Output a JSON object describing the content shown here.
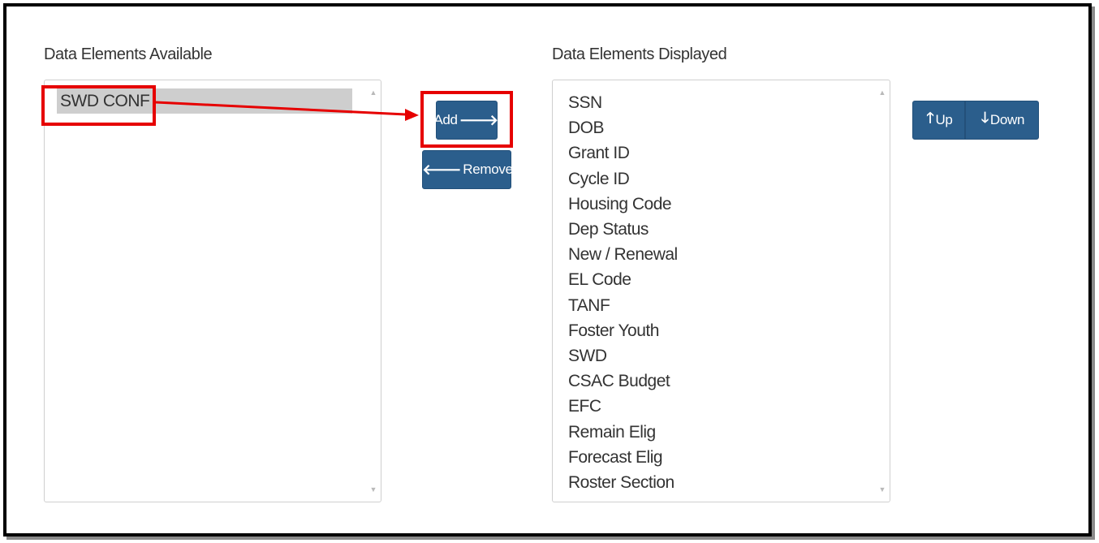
{
  "available": {
    "label": "Data Elements Available",
    "items": [
      "SWD CONF"
    ],
    "selected": "SWD CONF"
  },
  "displayed": {
    "label": "Data Elements Displayed",
    "items": [
      "SSN",
      "DOB",
      "Grant ID",
      "Cycle ID",
      "Housing Code",
      "Dep Status",
      "New / Renewal",
      "EL Code",
      "TANF",
      "Foster Youth",
      "SWD",
      "CSAC Budget",
      "EFC",
      "Remain Elig",
      "Forecast Elig",
      "Roster Section"
    ]
  },
  "buttons": {
    "add": "Add",
    "remove": "Remove",
    "up": "Up",
    "down": "Down"
  },
  "colors": {
    "button": "#2b5e8c",
    "highlight": "#e60000",
    "selection": "#cecece"
  }
}
